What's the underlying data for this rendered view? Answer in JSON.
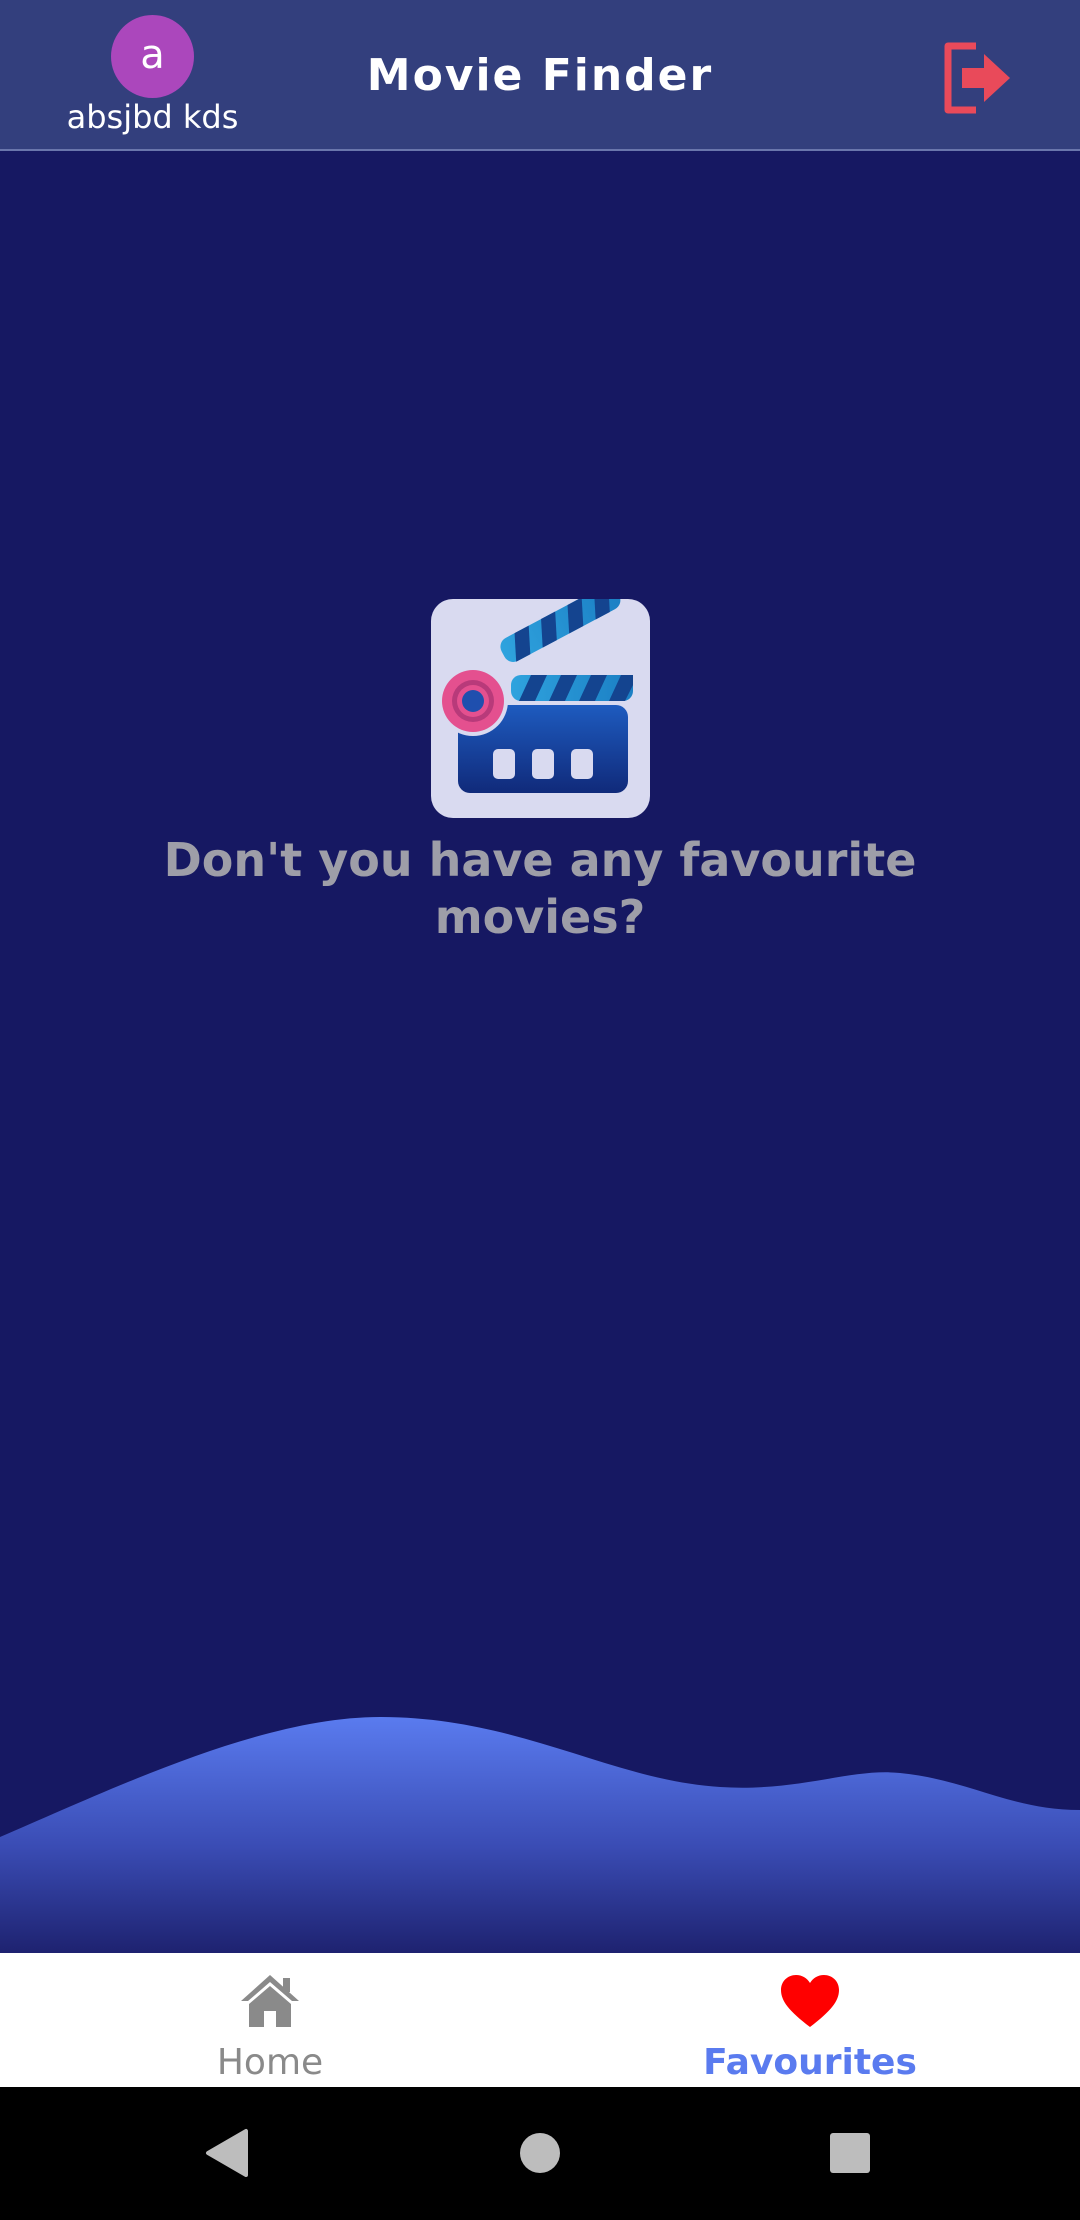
{
  "header": {
    "avatar_letter": "a",
    "user_name": "absjbd kds",
    "title": "Movie Finder",
    "logout_icon": "logout-icon"
  },
  "main": {
    "logo_icon": "clapperboard-icon",
    "empty_message": "Don't you have any favourite movies?"
  },
  "bottom_nav": {
    "items": [
      {
        "label": "Home",
        "icon": "home-icon",
        "selected": false
      },
      {
        "label": "Favourites",
        "icon": "heart-icon",
        "selected": true
      }
    ]
  },
  "system_nav": {
    "back_icon": "back-icon",
    "home_icon": "home-circle-icon",
    "recents_icon": "recents-icon"
  },
  "colors": {
    "background": "#161862",
    "app_bar": "#333f7d",
    "avatar": "#ab47bc",
    "logout": "#e94a5a",
    "accent": "#5a7bef",
    "heart": "#ff0000",
    "message_text": "#9e9ea8"
  }
}
